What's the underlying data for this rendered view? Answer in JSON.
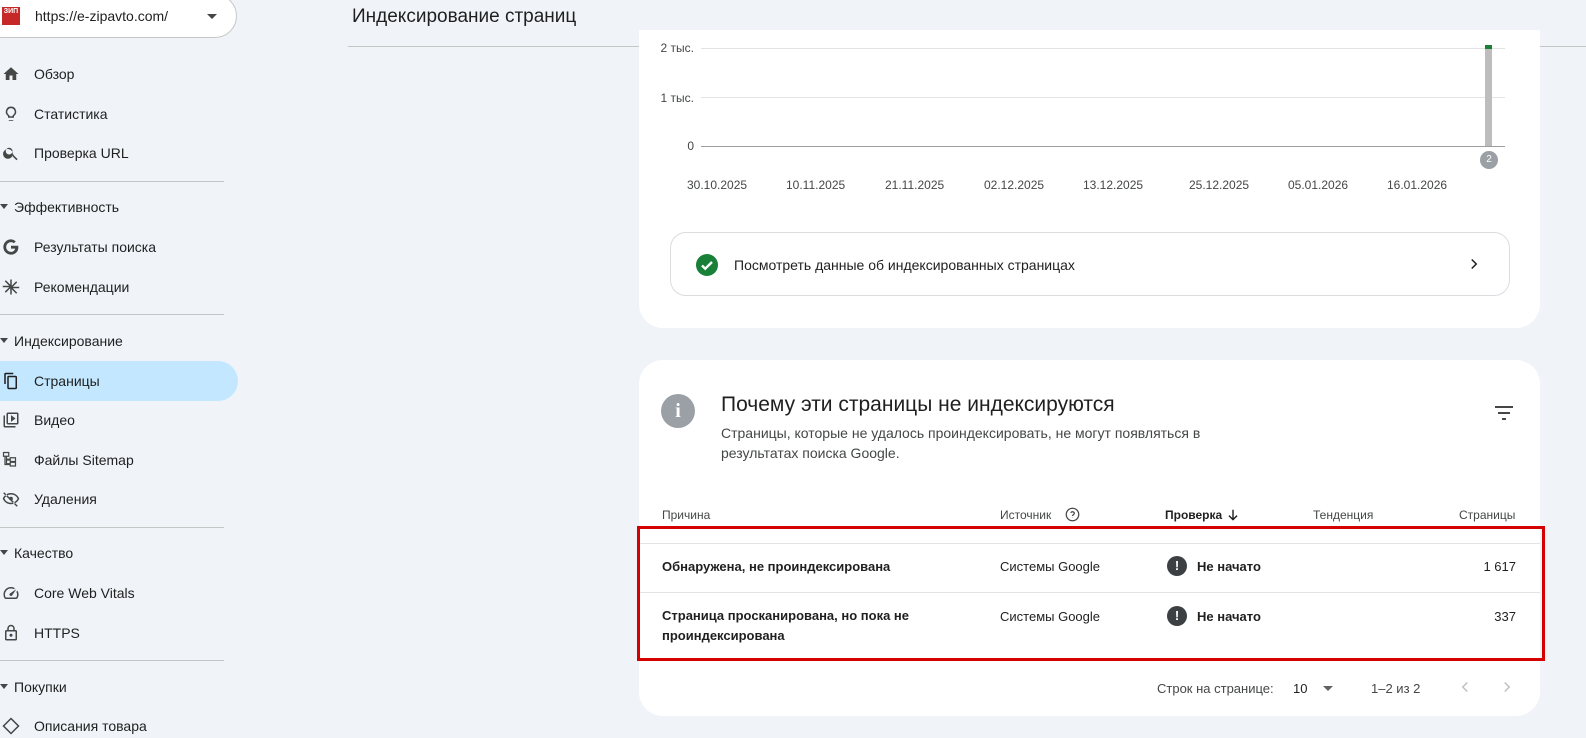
{
  "property": {
    "url": "https://e-zipavto.com/",
    "logo_text": "ЗИП АВТО"
  },
  "nav": {
    "top": [
      {
        "label": "Обзор"
      },
      {
        "label": "Статистика"
      },
      {
        "label": "Проверка URL"
      }
    ],
    "sections": [
      {
        "title": "Эффективность",
        "items": [
          {
            "label": "Результаты поиска"
          },
          {
            "label": "Рекомендации"
          }
        ]
      },
      {
        "title": "Индексирование",
        "items": [
          {
            "label": "Страницы"
          },
          {
            "label": "Видео"
          },
          {
            "label": "Файлы Sitemap"
          },
          {
            "label": "Удаления"
          }
        ]
      },
      {
        "title": "Качество",
        "items": [
          {
            "label": "Core Web Vitals"
          },
          {
            "label": "HTTPS"
          }
        ]
      },
      {
        "title": "Покупки",
        "items": [
          {
            "label": "Описания товара"
          }
        ]
      }
    ]
  },
  "header": {
    "title": "Индексирование страниц"
  },
  "chart": {
    "y_ticks": [
      "2 тыс.",
      "1 тыс.",
      "0"
    ],
    "x_ticks": [
      "30.10.2025",
      "10.11.2025",
      "21.11.2025",
      "02.12.2025",
      "13.12.2025",
      "25.12.2025",
      "05.01.2026",
      "16.01.2026"
    ],
    "marker_label": "2",
    "colors": {
      "not_indexed": "#bdbdbd",
      "indexed": "#188038"
    }
  },
  "view_indexed": {
    "label": "Посмотреть данные об индексированных страницах"
  },
  "reasons": {
    "title": "Почему эти страницы не индексируются",
    "description": "Страницы, которые не удалось проиндексировать, не могут появляться в результатах поиска Google.",
    "columns": {
      "reason": "Причина",
      "source": "Источник",
      "check": "Проверка",
      "trend": "Тенденция",
      "pages": "Страницы"
    },
    "rows": [
      {
        "reason": "Обнаружена, не проиндексирована",
        "source": "Системы Google",
        "status": "Не начато",
        "pages": "1 617"
      },
      {
        "reason": "Страница просканирована, но пока не проиндексирована",
        "source": "Системы Google",
        "status": "Не начато",
        "pages": "337"
      }
    ],
    "pagination": {
      "rows_label": "Строк на странице:",
      "rows_value": "10",
      "range": "1–2 из 2"
    }
  },
  "accent_color": "#c2e7ff",
  "highlight_color": "#d50000"
}
